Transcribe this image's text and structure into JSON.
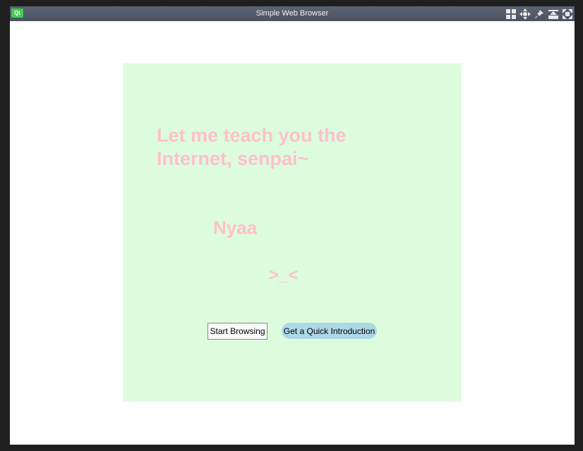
{
  "window": {
    "title": "Simple Web Browser",
    "logo_text": "Qt",
    "controls": [
      "layout-grid-icon",
      "move-icon",
      "pin-icon",
      "shade-icon",
      "fullscreen-icon"
    ]
  },
  "page": {
    "headline": "Let me teach you the Internet, senpai~",
    "nyaa": "Nyaa",
    "face": ">_<",
    "start_button": "Start Browsing",
    "intro_button": "Get a Quick Introduction",
    "colors": {
      "panel_background": "#ddfcdd",
      "text_pink": "#ffc0cb",
      "intro_button_background": "#add8e6"
    }
  }
}
